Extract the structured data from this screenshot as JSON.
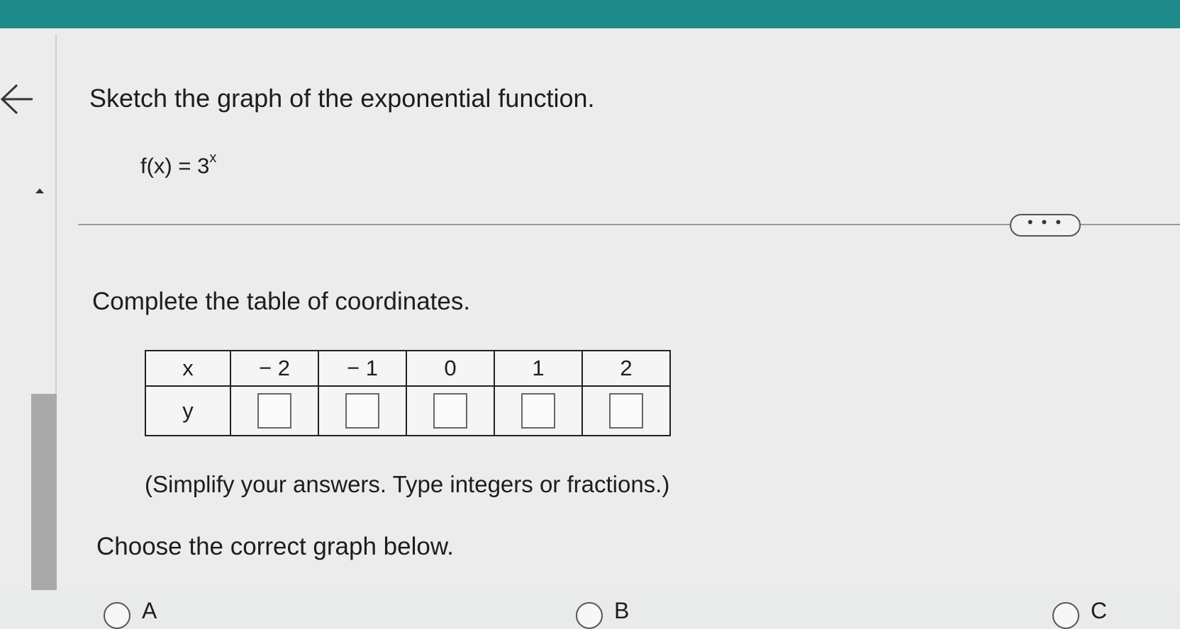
{
  "question": {
    "title": "Sketch the graph of the exponential function.",
    "function_base": "f(x) = 3",
    "function_exponent": "x"
  },
  "more_button": {
    "label": "• • •"
  },
  "table_section": {
    "instruction": "Complete the table of coordinates.",
    "x_header": "x",
    "y_header": "y",
    "x_values": [
      "− 2",
      "− 1",
      "0",
      "1",
      "2"
    ],
    "y_values": [
      "",
      "",
      "",
      "",
      ""
    ],
    "hint": "(Simplify your answers. Type integers or fractions.)"
  },
  "graph_section": {
    "instruction": "Choose the correct graph below.",
    "options": [
      "A",
      "B",
      "C"
    ]
  }
}
